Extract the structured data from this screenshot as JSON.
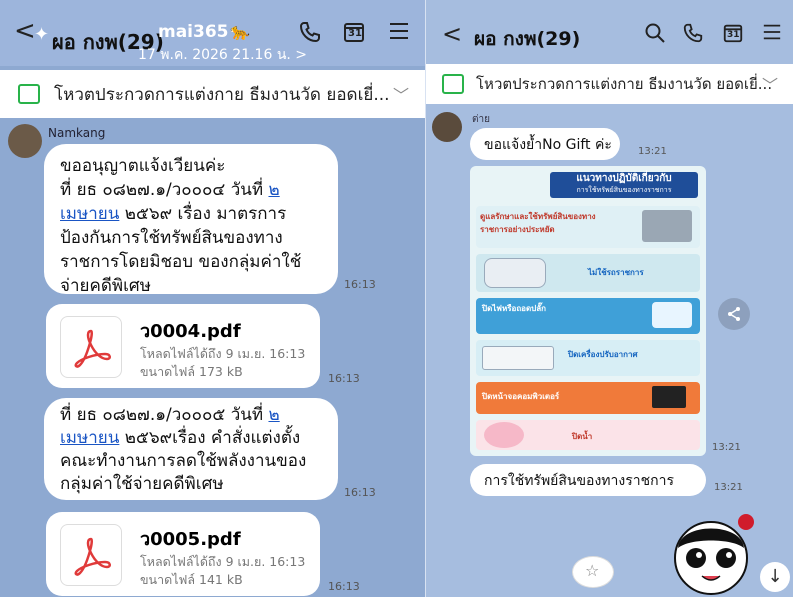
{
  "left": {
    "header": {
      "back": "<",
      "chat_title": "ผอ กงพ(29)",
      "overlay_title": "mai365",
      "overlay_date": "17 พ.ค. 2026 21.16 น. >",
      "icons": [
        "phone-icon",
        "calendar-icon",
        "menu-icon"
      ],
      "calendar_number": "31"
    },
    "notice": {
      "text": "โหวตประกวดการแต่งกาย ธีมงานวัด ยอดเยี่...",
      "chevron": "﹀"
    },
    "sender": "Namkang",
    "messages": [
      {
        "lines": [
          {
            "text": "ขออนุญาตแจ้งเวียนค่ะ"
          },
          {
            "text": "ที่ ยธ ๐๘๒๗.๑/ว๐๐๐๔ วันที่ ",
            "link": "๒"
          },
          {
            "link": "เมษายน",
            "text": " ๒๕๖๙ เรื่อง มาตรการ"
          },
          {
            "text": "ป้องกันการใช้ทรัพย์สินของทาง"
          },
          {
            "text": "ราชการโดยมิชอบ ของกลุ่มค่าใช้"
          },
          {
            "text": "จ่ายคดีพิเศษ"
          }
        ],
        "time": "16:13"
      },
      {
        "lines": [
          {
            "text": "ที่ ยธ ๐๘๒๗.๑/ว๐๐๐๕ วันที่ ",
            "link": "๒"
          },
          {
            "link": "เมษายน",
            "text": " ๒๕๖๙เรื่อง คำสั่งแต่งตั้ง"
          },
          {
            "text": "คณะทำงานการลดใช้พลังงานของ"
          },
          {
            "text": "กลุ่มค่าใช้จ่ายคดีพิเศษ"
          }
        ],
        "time": "16:13"
      }
    ],
    "files": [
      {
        "name": "ว0004.pdf",
        "download": "โหลดไฟล์ได้ถึง 9 เม.ย. 16:13",
        "size": "ขนาดไฟล์ 173 kB",
        "time": "16:13"
      },
      {
        "name": "ว0005.pdf",
        "download": "โหลดไฟล์ได้ถึง 9 เม.ย. 16:13",
        "size": "ขนาดไฟล์ 141 kB",
        "time": "16:13"
      }
    ]
  },
  "right": {
    "header": {
      "back": "<",
      "chat_title": "ผอ กงพ(29)",
      "icons": [
        "search-icon",
        "phone-icon",
        "calendar-icon",
        "menu-icon"
      ],
      "calendar_number": "31"
    },
    "notice": {
      "text": "โหวตประกวดการแต่งกาย ธีมงานวัด ยอดเยี่...",
      "chevron": "﹀"
    },
    "sender": "ต่าย",
    "messages": [
      {
        "text": "ขอแจ้งย้ำNo Gift ค่ะ",
        "time": "13:21"
      },
      {
        "text": "การใช้ทรัพย์สินของทางราชการ",
        "time": "13:21"
      }
    ],
    "poster": {
      "heading": "แนวทางปฏิบัติเกี่ยวกับ",
      "subheading": "การใช้ทรัพย์สินของทางราชการ",
      "items": [
        "ดูแลรักษาและใช้ทรัพย์สินของทางราชการอย่างประหยัด",
        "ไม่ใช้รถราชการ",
        "ปิดไฟหรือถอดปลั๊ก",
        "ปิดเครื่องปรับอากาศ",
        "ปิดหน้าจอคอมพิวเตอร์",
        "ปิดน้ำ"
      ],
      "time": "13:21"
    },
    "scroll_down": "↓"
  },
  "colors": {
    "accent_green": "#29b34a",
    "link_blue": "#1a55c4",
    "pdf_red": "#e03a3a"
  }
}
